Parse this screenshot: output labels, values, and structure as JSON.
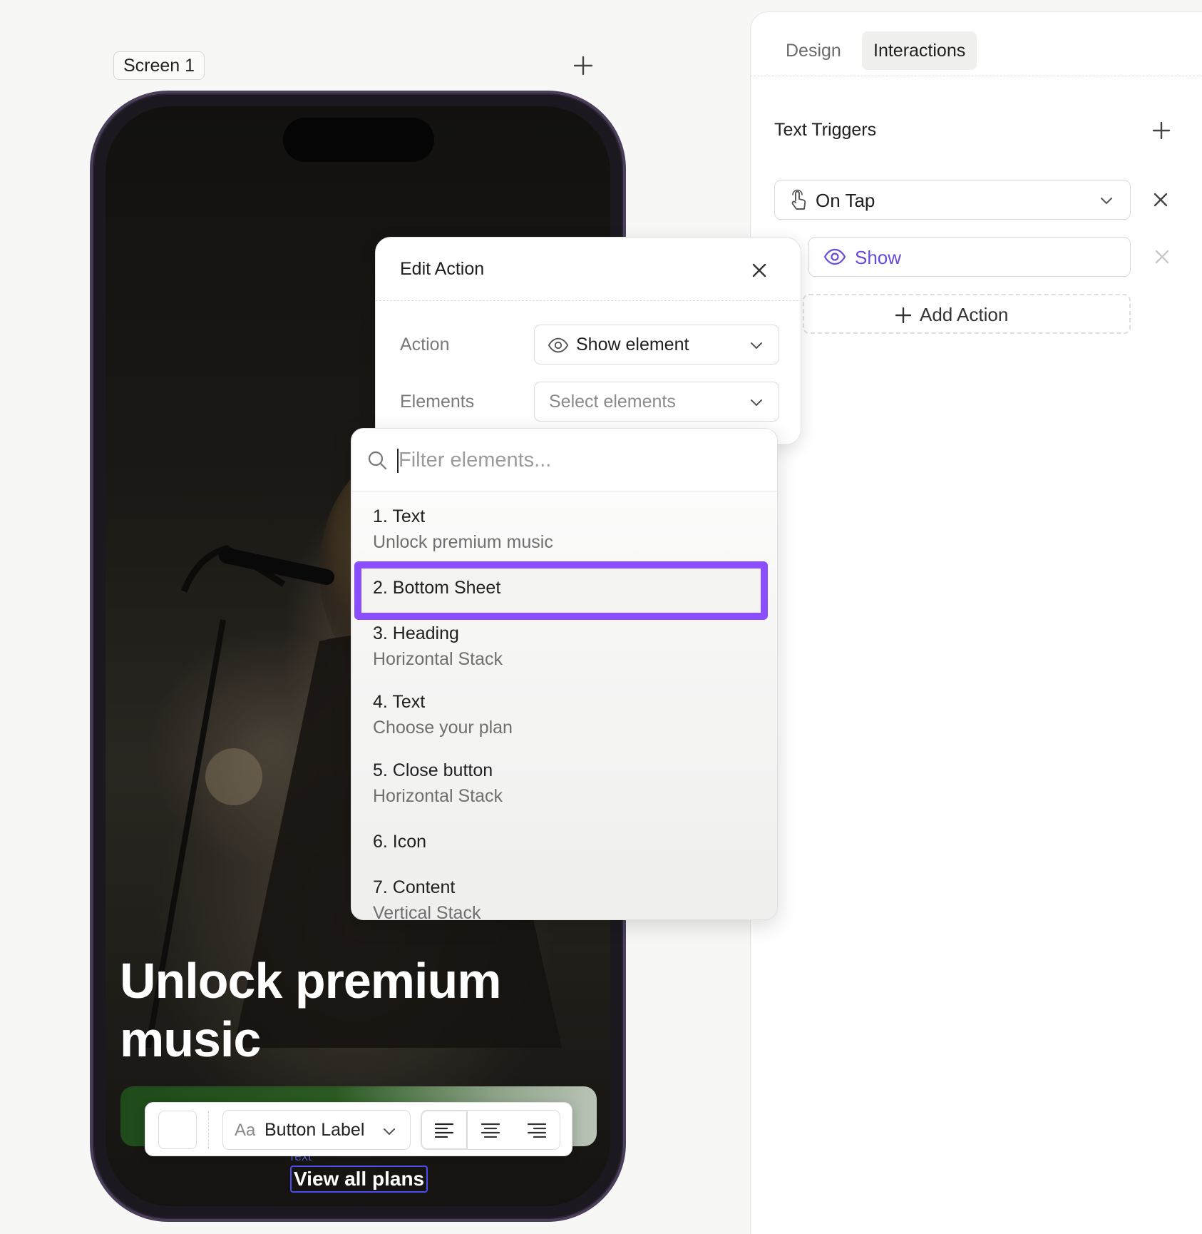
{
  "canvas": {
    "screen_label": "Screen 1"
  },
  "phone": {
    "hero_title": "Unlock premium music",
    "view_plans_tag": "Text",
    "view_plans_label": "View all plans"
  },
  "toolbar": {
    "font_prefix": "Aa",
    "font_label": "Button Label",
    "align_options": [
      "align-left",
      "align-center",
      "align-right"
    ],
    "active_align": "align-left"
  },
  "panel": {
    "tabs": [
      {
        "label": "Design",
        "active": false
      },
      {
        "label": "Interactions",
        "active": true
      }
    ],
    "section_title": "Text Triggers",
    "trigger": {
      "label": "On Tap",
      "icon": "tap-hand-icon"
    },
    "action": {
      "label": "Show",
      "icon": "eye-icon"
    },
    "add_action_label": "Add Action",
    "accent_color": "#6a4ad8"
  },
  "modal": {
    "title": "Edit Action",
    "action_label": "Action",
    "action_value": "Show element",
    "elements_label": "Elements",
    "elements_placeholder": "Select elements"
  },
  "dropdown": {
    "filter_placeholder": "Filter elements...",
    "highlight_color": "#8a4dff",
    "options": [
      {
        "title": "1. Text",
        "subtitle": "Unlock premium music"
      },
      {
        "title": "2. Bottom Sheet",
        "subtitle": ""
      },
      {
        "title": "3. Heading",
        "subtitle": "Horizontal Stack"
      },
      {
        "title": "4. Text",
        "subtitle": "Choose your plan"
      },
      {
        "title": "5. Close button",
        "subtitle": "Horizontal Stack"
      },
      {
        "title": "6. Icon",
        "subtitle": ""
      },
      {
        "title": "7. Content",
        "subtitle": "Vertical Stack"
      }
    ],
    "highlighted_index": 1
  }
}
